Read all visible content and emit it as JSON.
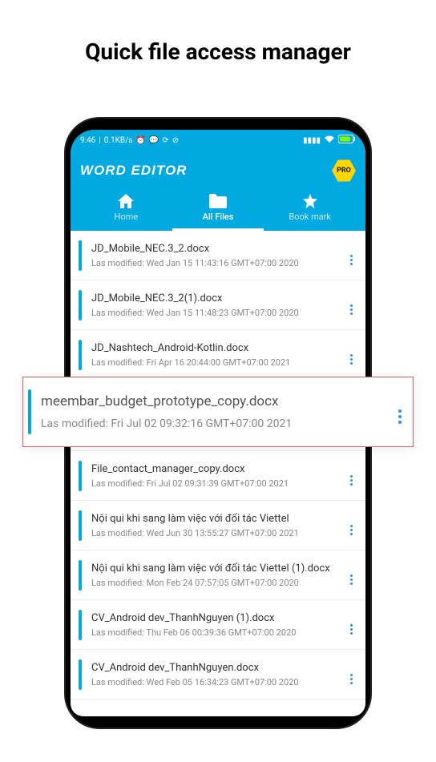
{
  "headline": "Quick file access manager",
  "status_bar": {
    "time": "9:46",
    "speed": "0.1KB/s",
    "icons": [
      "alarm-icon",
      "chat-icon",
      "sync-icon",
      "block-icon"
    ],
    "right_icons": [
      "signal-icon",
      "wifi-icon",
      "battery-icon"
    ]
  },
  "header": {
    "app_title": "WORD EDITOR",
    "pro_label": "PRO"
  },
  "tabs": [
    {
      "icon": "home-icon",
      "label": "Home",
      "active": false
    },
    {
      "icon": "folder-icon",
      "label": "All Files",
      "active": true
    },
    {
      "icon": "star-icon",
      "label": "Book mark",
      "active": false
    }
  ],
  "files": [
    {
      "name": "JD_Mobile_NEC.3_2.docx",
      "date": "Las modified: Wed Jan 15 11:43:16 GMT+07:00 2020"
    },
    {
      "name": "JD_Mobile_NEC.3_2(1).docx",
      "date": "Las modified: Wed Jan 15 11:48:23 GMT+07:00 2020"
    },
    {
      "name": "JD_Nashtech_Android-Kotlin.docx",
      "date": "Las modified: Fri Apr 16 20:44:00 GMT+07:00 2021"
    }
  ],
  "highlight": {
    "name": "meembar_budget_prototype_copy.docx",
    "date": "Las modified: Fri Jul 02 09:32:16 GMT+07:00 2021"
  },
  "files_after": [
    {
      "name": "File_contact_manager_copy.docx",
      "date": "Las modified: Fri Jul 02 09:31:39 GMT+07:00 2021"
    },
    {
      "name": "Nội qui khi sang làm việc với đối tác Viettel",
      "date": "Las modified: Wed Jun 30 13:55:27 GMT+07:00 2021"
    },
    {
      "name": "Nội qui khi sang làm việc với đối tác Viettel (1).docx",
      "date": "Las modified: Mon Feb 24 07:57:05 GMT+07:00 2020"
    },
    {
      "name": "CV_Android dev_ThanhNguyen (1).docx",
      "date": "Las modified: Thu Feb 06 00:39:36 GMT+07:00 2020"
    },
    {
      "name": "CV_Android dev_ThanhNguyen.docx",
      "date": "Las modified: Wed Feb 05 16:34:23 GMT+07:00 2020"
    }
  ]
}
